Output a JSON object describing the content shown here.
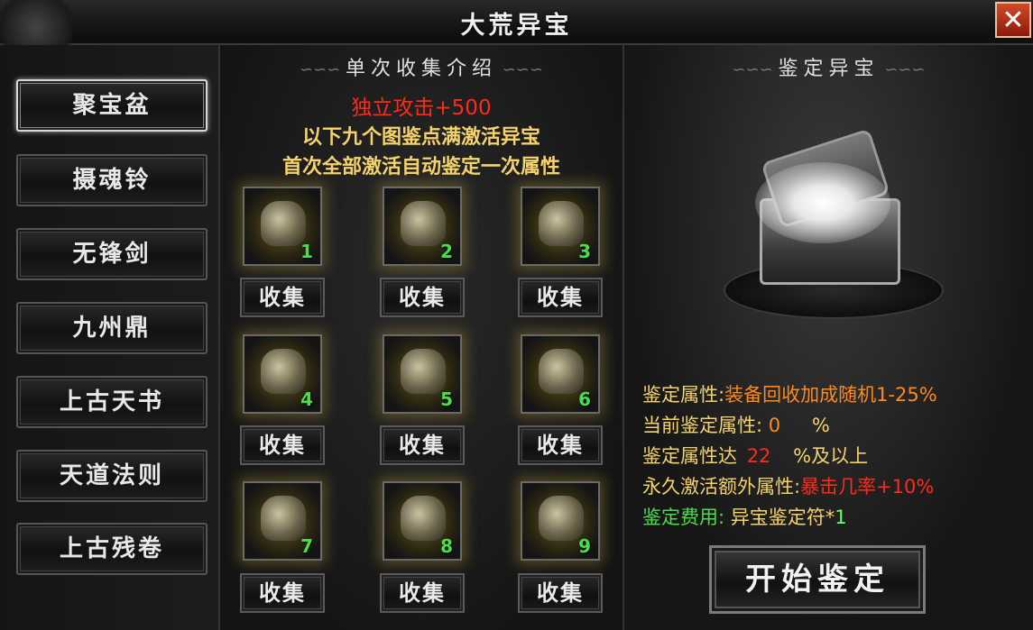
{
  "window": {
    "title": "大荒异宝",
    "close_glyph": "✕"
  },
  "sidebar": {
    "items": [
      {
        "label": "聚宝盆",
        "active": true
      },
      {
        "label": "摄魂铃",
        "active": false
      },
      {
        "label": "无锋剑",
        "active": false
      },
      {
        "label": "九州鼎",
        "active": false
      },
      {
        "label": "上古天书",
        "active": false
      },
      {
        "label": "天道法则",
        "active": false
      },
      {
        "label": "上古残卷",
        "active": false
      }
    ]
  },
  "collection": {
    "heading": "单次收集介绍",
    "bonus": "独立攻击+500",
    "line1": "以下九个图鉴点满激活异宝",
    "line2": "首次全部激活自动鉴定一次属性",
    "slots": [
      {
        "num": "1",
        "button": "收集"
      },
      {
        "num": "2",
        "button": "收集"
      },
      {
        "num": "3",
        "button": "收集"
      },
      {
        "num": "4",
        "button": "收集"
      },
      {
        "num": "5",
        "button": "收集"
      },
      {
        "num": "6",
        "button": "收集"
      },
      {
        "num": "7",
        "button": "收集"
      },
      {
        "num": "8",
        "button": "收集"
      },
      {
        "num": "9",
        "button": "收集"
      }
    ]
  },
  "identify": {
    "heading": "鉴定异宝",
    "attr_label": "鉴定属性:",
    "attr_value": "装备回收加成随机1-25%",
    "current_label": "当前鉴定属性:",
    "current_value": "0",
    "current_unit": "%",
    "reach_label": "鉴定属性达",
    "reach_value": "22",
    "reach_suffix": "%及以上",
    "perm_label": "永久激活额外属性:",
    "perm_value": "暴击几率+10%",
    "cost_label": "鉴定费用:",
    "cost_item": "异宝鉴定符*",
    "cost_qty": "1",
    "start_button": "开始鉴定"
  },
  "colors": {
    "gold": "#f5d36a",
    "red": "#ff2a1a",
    "orange": "#ff8a1a",
    "green": "#4ade4a"
  }
}
